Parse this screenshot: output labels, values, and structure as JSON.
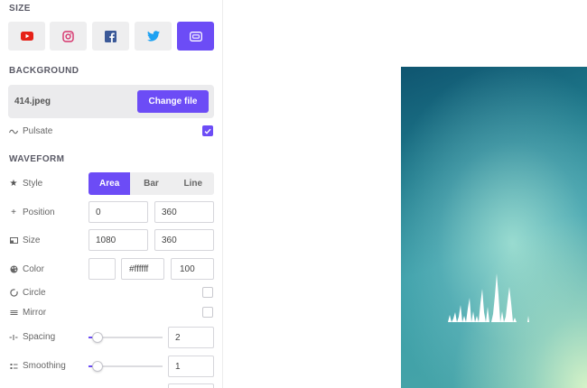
{
  "size": {
    "title": "SIZE",
    "buttons": [
      {
        "name": "youtube",
        "icon": "youtube-icon",
        "active": false
      },
      {
        "name": "instagram",
        "icon": "instagram-icon",
        "active": false
      },
      {
        "name": "facebook",
        "icon": "facebook-icon",
        "active": false
      },
      {
        "name": "twitter",
        "icon": "twitter-icon",
        "active": false
      },
      {
        "name": "hd",
        "icon": "hd-icon",
        "active": true
      }
    ]
  },
  "background": {
    "title": "BACKGROUND",
    "file_name": "414.jpeg",
    "change_label": "Change file",
    "pulsate_label": "Pulsate",
    "pulsate_checked": true
  },
  "waveform": {
    "title": "WAVEFORM",
    "style": {
      "label": "Style",
      "options": [
        "Area",
        "Bar",
        "Line"
      ],
      "selected": "Area"
    },
    "position": {
      "label": "Position",
      "x": "0",
      "y": "360"
    },
    "size": {
      "label": "Size",
      "width": "1080",
      "height": "360"
    },
    "color": {
      "label": "Color",
      "hex": "#ffffff",
      "opacity": "100"
    },
    "circle": {
      "label": "Circle",
      "checked": false
    },
    "mirror": {
      "label": "Mirror",
      "checked": false
    },
    "spacing": {
      "label": "Spacing",
      "value": "2",
      "fraction": 0.12
    },
    "smoothing": {
      "label": "Smoothing",
      "value": "1",
      "fraction": 0.12
    }
  },
  "colors": {
    "accent": "#6c4cf6",
    "youtube": "#e62117",
    "instagram": "#d6336c",
    "facebook": "#3b5998",
    "twitter": "#1da1f2"
  }
}
